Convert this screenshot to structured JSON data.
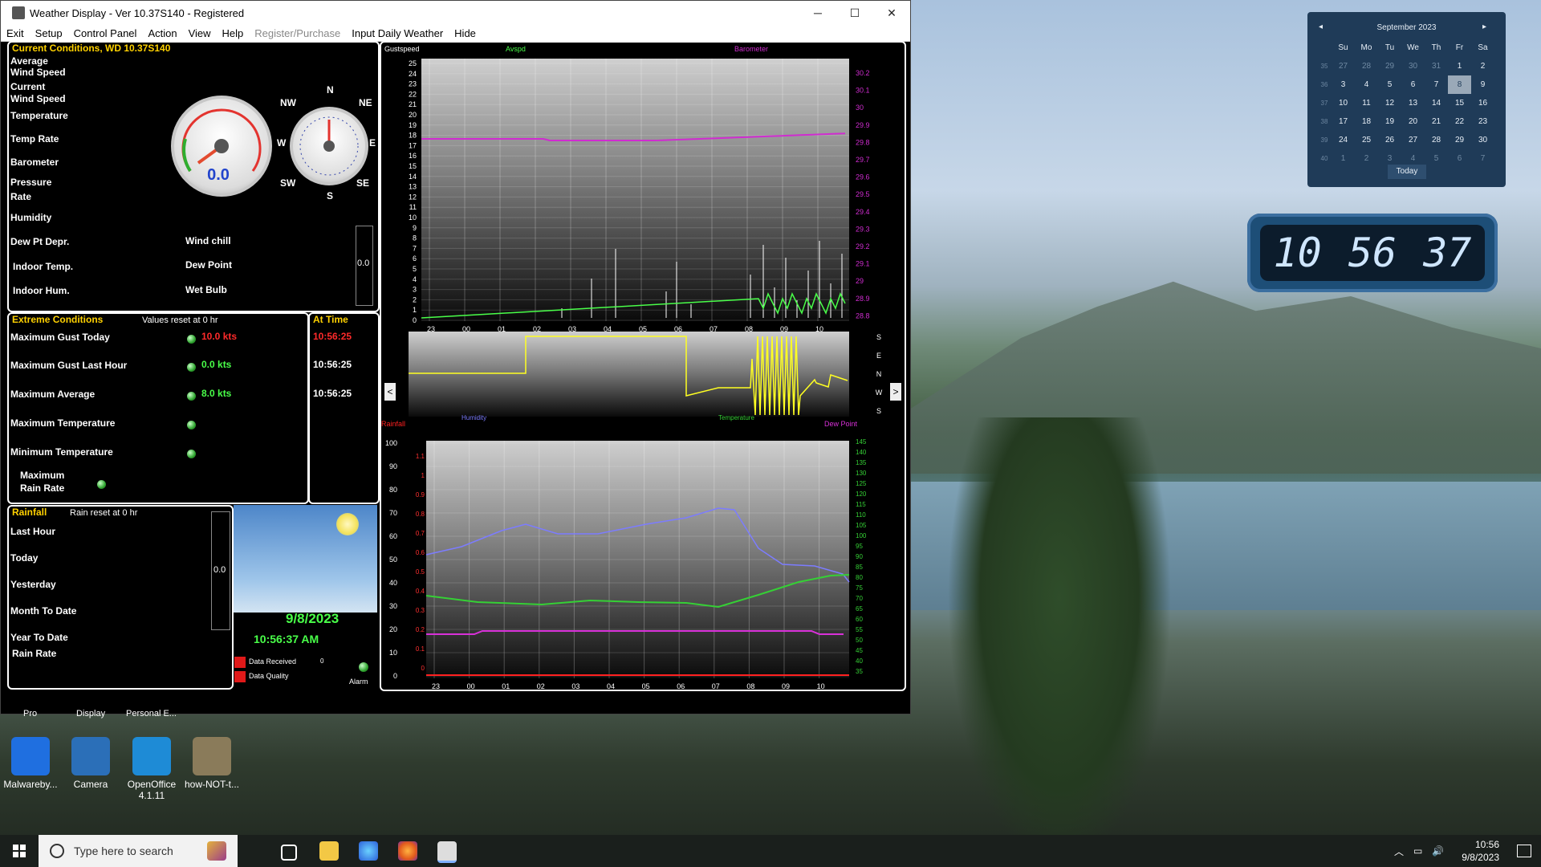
{
  "window": {
    "title": "Weather Display - Ver 10.37S140 - Registered",
    "minimize_glyph": "─",
    "maximize_glyph": "☐",
    "close_glyph": "✕"
  },
  "menu": [
    {
      "label": "Exit",
      "enabled": true
    },
    {
      "label": "Setup",
      "enabled": true
    },
    {
      "label": "Control Panel",
      "enabled": true
    },
    {
      "label": "Action",
      "enabled": true
    },
    {
      "label": "View",
      "enabled": true
    },
    {
      "label": "Help",
      "enabled": true
    },
    {
      "label": "Register/Purchase",
      "enabled": false
    },
    {
      "label": "Input Daily Weather",
      "enabled": true
    },
    {
      "label": "Hide",
      "enabled": true
    }
  ],
  "current": {
    "header": "Current Conditions, WD 10.37S140",
    "avg_wind_1": "Average",
    "avg_wind_2": "Wind Speed",
    "cur_wind_1": "Current",
    "cur_wind_2": "Wind Speed",
    "temperature": "Temperature",
    "temp_rate": "Temp Rate",
    "barometer": "Barometer",
    "pressure_1": "Pressure",
    "pressure_2": "Rate",
    "humidity": "Humidity",
    "dewpt_depr": "Dew Pt Depr.",
    "indoor_temp": "Indoor Temp.",
    "indoor_hum": "Indoor Hum.",
    "wind_chill": "Wind chill",
    "dew_point": "Dew Point",
    "wet_bulb": "Wet Bulb",
    "gauge_value": "0.0",
    "side_value": "0.0",
    "compass": {
      "n": "N",
      "ne": "NE",
      "e": "E",
      "se": "SE",
      "s": "S",
      "sw": "SW",
      "w": "W",
      "nw": "NW"
    }
  },
  "extreme": {
    "header": "Extreme Conditions",
    "reset_note": "Values reset at 0 hr",
    "at_time": "At Time",
    "rows": [
      {
        "label": "Maximum Gust Today",
        "value": "10.0 kts",
        "time": "10:56:25",
        "value_color": "red",
        "time_color": "red"
      },
      {
        "label": "Maximum Gust Last Hour",
        "value": "0.0 kts",
        "time": "10:56:25",
        "value_color": "green",
        "time_color": "white"
      },
      {
        "label": "Maximum Average",
        "value": "8.0 kts",
        "time": "10:56:25",
        "value_color": "green",
        "time_color": "white"
      },
      {
        "label": "Maximum Temperature",
        "value": "",
        "time": ""
      },
      {
        "label": "Minimum Temperature",
        "value": "",
        "time": ""
      }
    ],
    "max_rain_1": "Maximum",
    "max_rain_2": "Rain Rate"
  },
  "rain": {
    "header": "Rainfall",
    "reset_note": "Rain reset at 0 hr",
    "rows": [
      "Last Hour",
      "Today",
      "Yesterday",
      "Month To Date",
      "Year To Date"
    ],
    "rain_rate": "Rain Rate",
    "side_value": "0.0"
  },
  "datetime": {
    "date": "9/8/2023",
    "time": "10:56:37 AM",
    "data_received": "Data Received",
    "data_received_count": "0",
    "data_quality": "Data Quality",
    "alarm": "Alarm"
  },
  "graph_top": {
    "legend": [
      "Gustspeed",
      "Avspd",
      "Barometer"
    ],
    "y_left": [
      "25",
      "24",
      "23",
      "22",
      "21",
      "20",
      "19",
      "18",
      "17",
      "16",
      "15",
      "14",
      "13",
      "12",
      "11",
      "10",
      "9",
      "8",
      "7",
      "6",
      "5",
      "4",
      "3",
      "2",
      "1",
      "0"
    ],
    "y_right": [
      "30.2",
      "30.1",
      "30",
      "29.9",
      "29.8",
      "29.7",
      "29.6",
      "29.5",
      "29.4",
      "29.3",
      "29.2",
      "29.1",
      "29",
      "28.9",
      "28.8"
    ],
    "x": [
      "23",
      "00",
      "01",
      "02",
      "03",
      "04",
      "05",
      "06",
      "07",
      "08",
      "09",
      "10"
    ]
  },
  "graph_mid": {
    "y_right": [
      "S",
      "E",
      "N",
      "W",
      "S"
    ],
    "prev": "<",
    "next": ">"
  },
  "graph_bottom": {
    "legend": [
      "Rainfall",
      "Humidity",
      "Temperature",
      "Dew Point"
    ],
    "y_left": [
      "100",
      "90",
      "80",
      "70",
      "60",
      "50",
      "40",
      "30",
      "20",
      "10",
      "0"
    ],
    "y_rain": [
      "1.1",
      "1",
      "0.9",
      "0.8",
      "0.7",
      "0.6",
      "0.5",
      "0.4",
      "0.3",
      "0.2",
      "0.1",
      "0"
    ],
    "y_right": [
      "145",
      "140",
      "135",
      "130",
      "125",
      "120",
      "115",
      "110",
      "105",
      "100",
      "95",
      "90",
      "85",
      "80",
      "75",
      "70",
      "65",
      "60",
      "55",
      "50",
      "45",
      "40",
      "35"
    ],
    "x": [
      "23",
      "00",
      "01",
      "02",
      "03",
      "04",
      "05",
      "06",
      "07",
      "08",
      "09",
      "10"
    ]
  },
  "calendar": {
    "month": "September 2023",
    "prev": "◂",
    "next": "▸",
    "days": [
      "Su",
      "Mo",
      "Tu",
      "We",
      "Th",
      "Fr",
      "Sa"
    ],
    "weeks": [
      {
        "wk": "35",
        "d": [
          "27",
          "28",
          "29",
          "30",
          "31",
          "1",
          "2"
        ]
      },
      {
        "wk": "36",
        "d": [
          "3",
          "4",
          "5",
          "6",
          "7",
          "8",
          "9"
        ]
      },
      {
        "wk": "37",
        "d": [
          "10",
          "11",
          "12",
          "13",
          "14",
          "15",
          "16"
        ]
      },
      {
        "wk": "38",
        "d": [
          "17",
          "18",
          "19",
          "20",
          "21",
          "22",
          "23"
        ]
      },
      {
        "wk": "39",
        "d": [
          "24",
          "25",
          "26",
          "27",
          "28",
          "29",
          "30"
        ]
      },
      {
        "wk": "40",
        "d": [
          "1",
          "2",
          "3",
          "4",
          "5",
          "6",
          "7"
        ]
      }
    ],
    "today_label": "Today"
  },
  "clock": {
    "h": "10",
    "m": "56",
    "s": "37"
  },
  "desktop_partial_labels": [
    "Pro",
    "Display",
    "Personal E..."
  ],
  "desktop_icons": [
    {
      "label": "Malwareby...",
      "color": "#1f6fe0"
    },
    {
      "label": "Camera",
      "color": "#2b6fb8"
    },
    {
      "label": "OpenOffice 4.1.11",
      "color": "#1e8bd6"
    },
    {
      "label": "how-NOT-t...",
      "color": "#8a7b5a"
    }
  ],
  "taskbar": {
    "search_placeholder": "Type here to search",
    "time": "10:56",
    "date": "9/8/2023"
  },
  "colors": {
    "header_yellow": "#ffd100",
    "gust_white": "#ffffff",
    "avg_green": "#49ff49",
    "baro_magenta": "#d02cd0",
    "wind_dir_yellow": "#ffff22",
    "humidity_blue": "#7c7cff",
    "temperature_green": "#35d035",
    "dewpoint_magenta": "#d830d8"
  }
}
